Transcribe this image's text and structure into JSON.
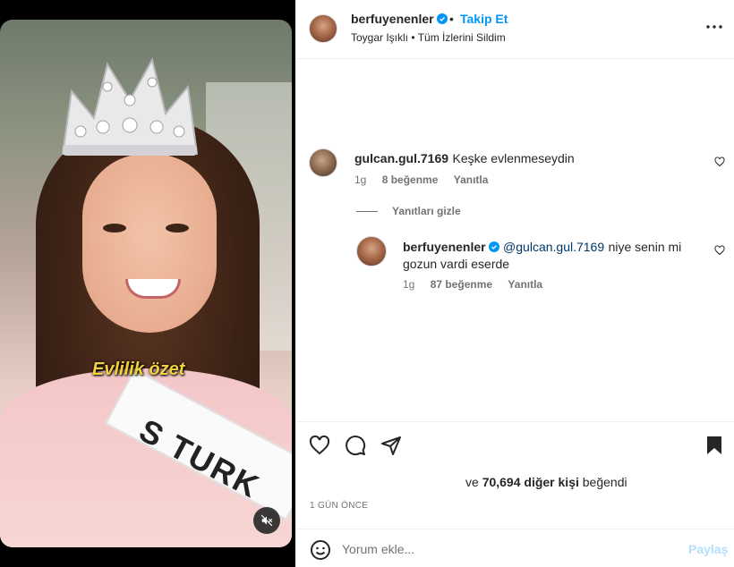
{
  "post": {
    "username": "berfuyenenler",
    "follow_label": "Takip Et",
    "separator": "•",
    "audio_artist": "Toygar Işıklı",
    "audio_song": "Tüm İzlerini Sildim",
    "overlay_caption": "Evlilik özet",
    "sash_text": "S TURK"
  },
  "comments": [
    {
      "username": "gulcan.gul.7169",
      "text": "Keşke evlenmeseydin",
      "time": "1g",
      "likes": "8 beğenme",
      "reply_label": "Yanıtla"
    }
  ],
  "replies_toggle": "Yanıtları gizle",
  "replies": [
    {
      "username": "berfuyenenler",
      "mention": "@gulcan.gul.7169",
      "text": "niye senin mi gozun vardi eserde",
      "time": "1g",
      "likes": "87 beğenme",
      "reply_label": "Yanıtla"
    }
  ],
  "likes_line": {
    "prefix": "ve",
    "count": "70,694 diğer kişi",
    "suffix": "beğendi"
  },
  "timestamp": "1 GÜN ÖNCE",
  "add_comment": {
    "placeholder": "Yorum ekle...",
    "post_label": "Paylaş"
  },
  "colors": {
    "accent": "#0095f6",
    "verified": "#0095f6",
    "overlay_text": "#f2d13c",
    "post_disabled": "#b2dffc"
  },
  "icons": [
    "verified-icon",
    "more-options-icon",
    "heart-icon",
    "comment-icon",
    "share-icon",
    "bookmark-icon",
    "emoji-icon",
    "mute-icon"
  ]
}
